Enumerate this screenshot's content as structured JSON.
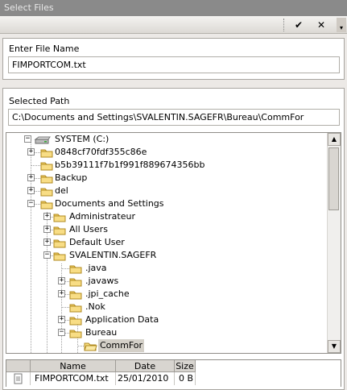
{
  "window": {
    "title": "Select Files"
  },
  "toolbar": {
    "ok_glyph": "✔",
    "close_glyph": "✕",
    "menu_glyph": "▾"
  },
  "file_name": {
    "label": "Enter File Name",
    "value": "FIMPORTCOM.txt"
  },
  "path": {
    "label": "Selected Path",
    "value": "C:\\Documents and Settings\\SVALENTIN.SAGEFR\\Bureau\\CommFor"
  },
  "tree": {
    "root": {
      "label": "SYSTEM (C:)",
      "icon": "drive-icon",
      "expanded": true
    },
    "items": [
      {
        "label": "0848cf70fdf355c86e",
        "expander": "plus",
        "level": 1
      },
      {
        "label": "b5b39111f7b1f991f889674356bb",
        "expander": "none",
        "level": 1
      },
      {
        "label": "Backup",
        "expander": "plus",
        "level": 1
      },
      {
        "label": "del",
        "expander": "plus",
        "level": 1
      },
      {
        "label": "Documents and Settings",
        "expander": "minus",
        "level": 1
      },
      {
        "label": "Administrateur",
        "expander": "plus",
        "level": 2
      },
      {
        "label": "All Users",
        "expander": "plus",
        "level": 2
      },
      {
        "label": "Default User",
        "expander": "plus",
        "level": 2
      },
      {
        "label": "SVALENTIN.SAGEFR",
        "expander": "minus",
        "level": 2
      },
      {
        "label": ".java",
        "expander": "none",
        "level": 3
      },
      {
        "label": ".javaws",
        "expander": "plus",
        "level": 3
      },
      {
        "label": ".jpi_cache",
        "expander": "plus",
        "level": 3
      },
      {
        "label": ".Nok",
        "expander": "none",
        "level": 3
      },
      {
        "label": "Application Data",
        "expander": "plus",
        "level": 3
      },
      {
        "label": "Bureau",
        "expander": "minus",
        "level": 3
      },
      {
        "label": "CommFor",
        "expander": "none",
        "level": 4,
        "selected": true,
        "open": true
      }
    ]
  },
  "files": {
    "columns": [
      "Name",
      "Date",
      "Size"
    ],
    "rows": [
      {
        "name": "FIMPORTCOM.txt",
        "date": "25/01/2010",
        "size": "0 B",
        "icon": "text-file-icon"
      }
    ]
  },
  "colors": {
    "titlebar": "#8a8a8a",
    "folder": "#f5d26a",
    "selection": "#d4d0c8"
  }
}
